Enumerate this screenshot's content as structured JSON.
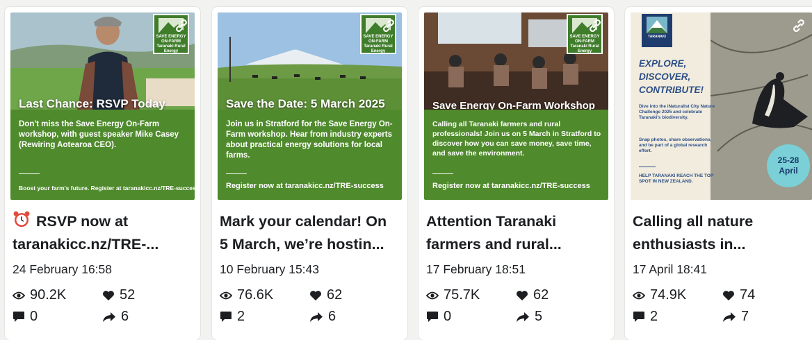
{
  "colors": {
    "accent_green": "#4f8a2c",
    "text_dark": "#1c1e21",
    "poster_blue": "#2c4e86"
  },
  "posts": [
    {
      "thumb": {
        "badge": "SAVE ENERGY ON-FARM",
        "badge_sub": "Taranaki Rural Energy",
        "photo_title": "Last Chance: RSVP Today",
        "body": "Don't miss the Save Energy On-Farm workshop, with guest speaker Mike Casey (Rewiring Aotearoa CEO).",
        "footer": "Boost your farm's future. Register at taranakicc.nz/TRE-success"
      },
      "title_line1": "RSVP now at",
      "title_line2": "taranakicc.nz/TRE-...",
      "title_icon": "alarm-clock-icon",
      "date": "24 February 16:58",
      "views": "90.2K",
      "likes": "52",
      "comments": "0",
      "shares": "6"
    },
    {
      "thumb": {
        "badge": "SAVE ENERGY ON-FARM",
        "badge_sub": "Taranaki Rural Energy",
        "photo_title": "Save the Date: 5 March 2025",
        "body": "Join us in Stratford for the Save Energy On-Farm workshop. Hear from industry experts about practical energy solutions for local farms.",
        "footer": "Register now at taranakicc.nz/TRE-success"
      },
      "title_line1": "Mark your calendar! On",
      "title_line2": "5 March, we’re hostin...",
      "date": "10 February 15:43",
      "views": "76.6K",
      "likes": "62",
      "comments": "2",
      "shares": "6"
    },
    {
      "thumb": {
        "badge": "SAVE ENERGY ON-FARM",
        "badge_sub": "Taranaki Rural Energy",
        "photo_title": "Save Energy On-Farm Workshop",
        "body": "Calling all Taranaki farmers and rural professionals! Join us on 5 March in Stratford to discover how you can save money, save time, and save the environment.",
        "footer": "Register now at taranakicc.nz/TRE-success"
      },
      "title_line1": "Attention Taranaki",
      "title_line2": "farmers and rural...",
      "date": "17 February 18:51",
      "views": "75.7K",
      "likes": "62",
      "comments": "0",
      "shares": "5"
    },
    {
      "thumb": {
        "badge": "TARANAKI",
        "heading_line1": "EXPLORE,",
        "heading_line2": "DISCOVER,",
        "heading_line3": "CONTRIBUTE!",
        "para1": "Dive into the iNaturalist City Nature Challenge 2025 and celebrate Taranaki's biodiversity.",
        "para2": "Snap photos, share observations, and be part of a global research effort.",
        "footer": "HELP TARANAKI REACH THE TOP SPOT IN NEW ZEALAND.",
        "date_line1": "25-28",
        "date_line2": "April"
      },
      "title_line1": "Calling all nature",
      "title_line2": "enthusiasts in...",
      "date": "17 April 18:41",
      "views": "74.9K",
      "likes": "74",
      "comments": "2",
      "shares": "7"
    }
  ]
}
